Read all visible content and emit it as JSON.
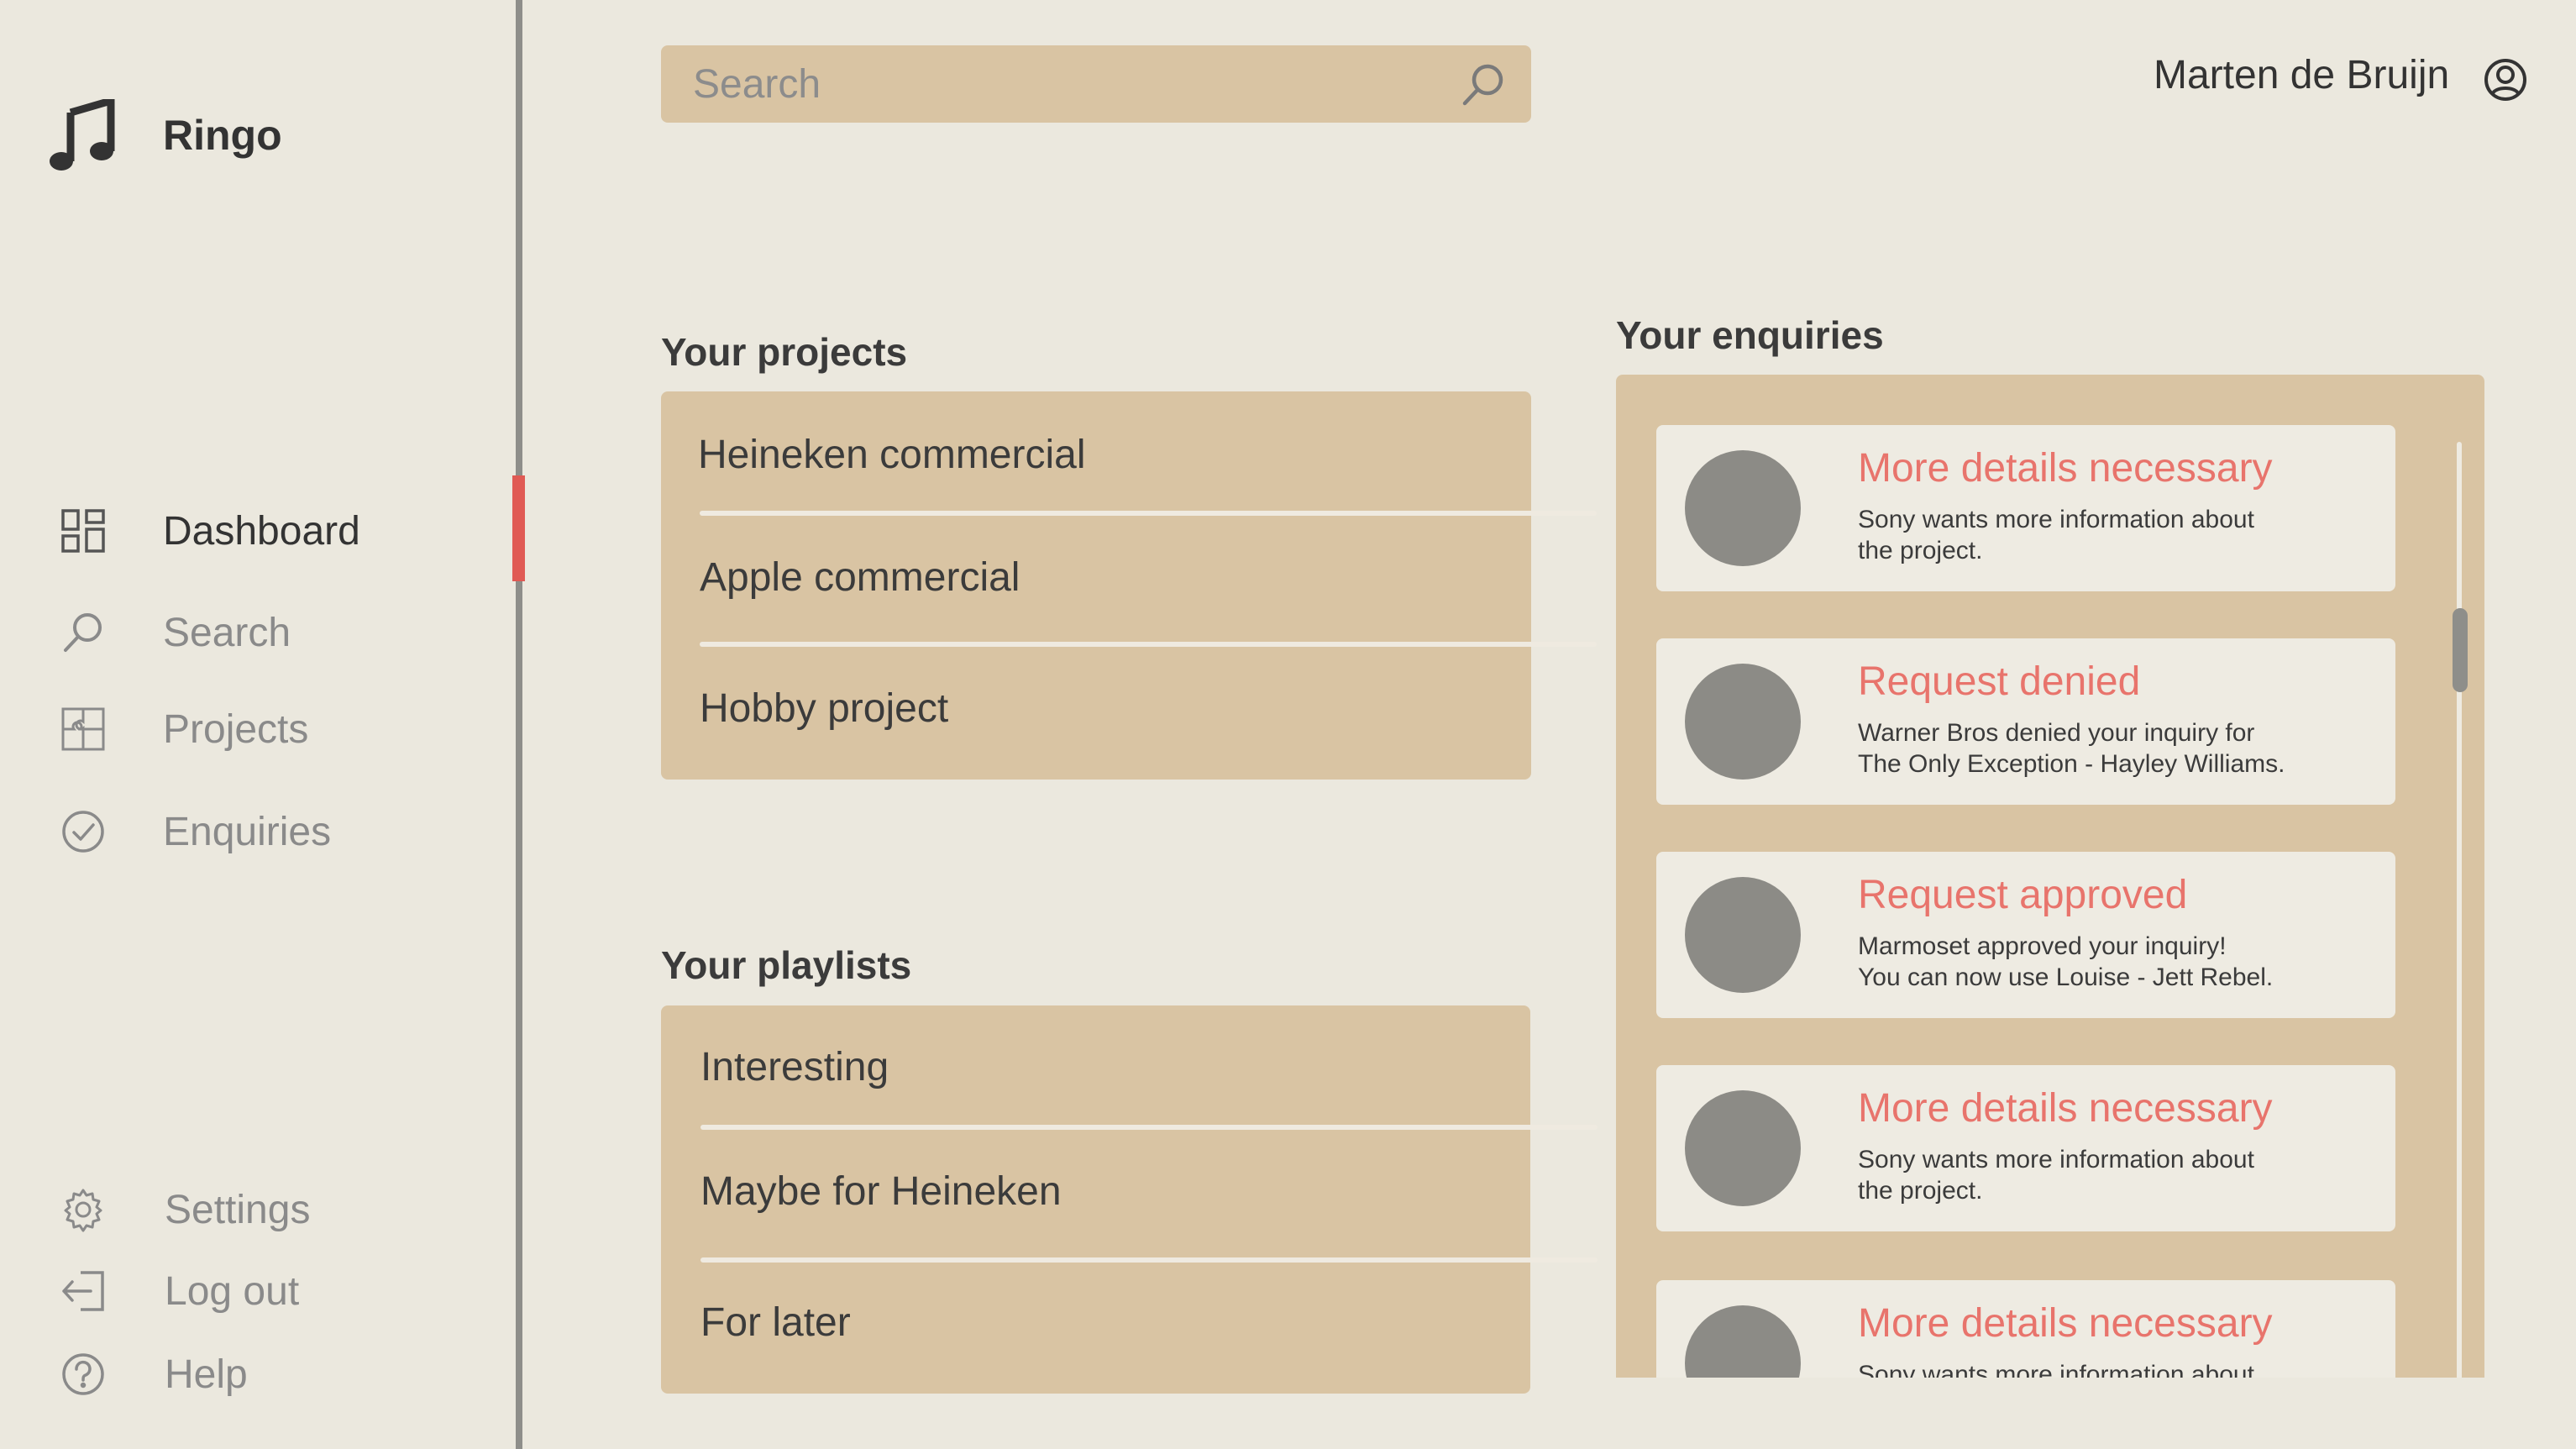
{
  "app": {
    "name": "Ringo",
    "logo_icon": "music-note-icon"
  },
  "sidebar": {
    "nav": [
      {
        "label": "Dashboard",
        "icon": "dashboard-grid-icon",
        "active": true
      },
      {
        "label": "Search",
        "icon": "search-icon",
        "active": false
      },
      {
        "label": "Projects",
        "icon": "puzzle-icon",
        "active": false
      },
      {
        "label": "Enquiries",
        "icon": "check-circle-icon",
        "active": false
      }
    ],
    "footer": [
      {
        "label": "Settings",
        "icon": "gear-icon"
      },
      {
        "label": "Log out",
        "icon": "logout-icon"
      },
      {
        "label": "Help",
        "icon": "help-icon"
      }
    ]
  },
  "search": {
    "placeholder": "Search",
    "value": ""
  },
  "user": {
    "name": "Marten de Bruijn",
    "icon": "user-circle-icon"
  },
  "projects": {
    "title": "Your projects",
    "items": [
      "Heineken commercial",
      "Apple commercial",
      "Hobby project"
    ]
  },
  "playlists": {
    "title": "Your playlists",
    "items": [
      "Interesting",
      "Maybe for Heineken",
      "For later"
    ]
  },
  "enquiries": {
    "title": "Your enquiries",
    "items": [
      {
        "title": "More details necessary",
        "text": "Sony wants more information about\nthe project."
      },
      {
        "title": "Request denied",
        "text": "Warner Bros denied your inquiry for\nThe Only Exception - Hayley Williams."
      },
      {
        "title": "Request approved",
        "text": "Marmoset approved your inquiry!\nYou can now use Louise - Jett Rebel."
      },
      {
        "title": "More details necessary",
        "text": "Sony wants more information about\nthe project."
      },
      {
        "title": "More details necessary",
        "text": "Sony wants more information about\nthe project."
      }
    ]
  },
  "colors": {
    "background": "#ebe8de",
    "card": "#d9c4a3",
    "accent": "#e05a54",
    "enquiry_title": "#e8746c"
  }
}
